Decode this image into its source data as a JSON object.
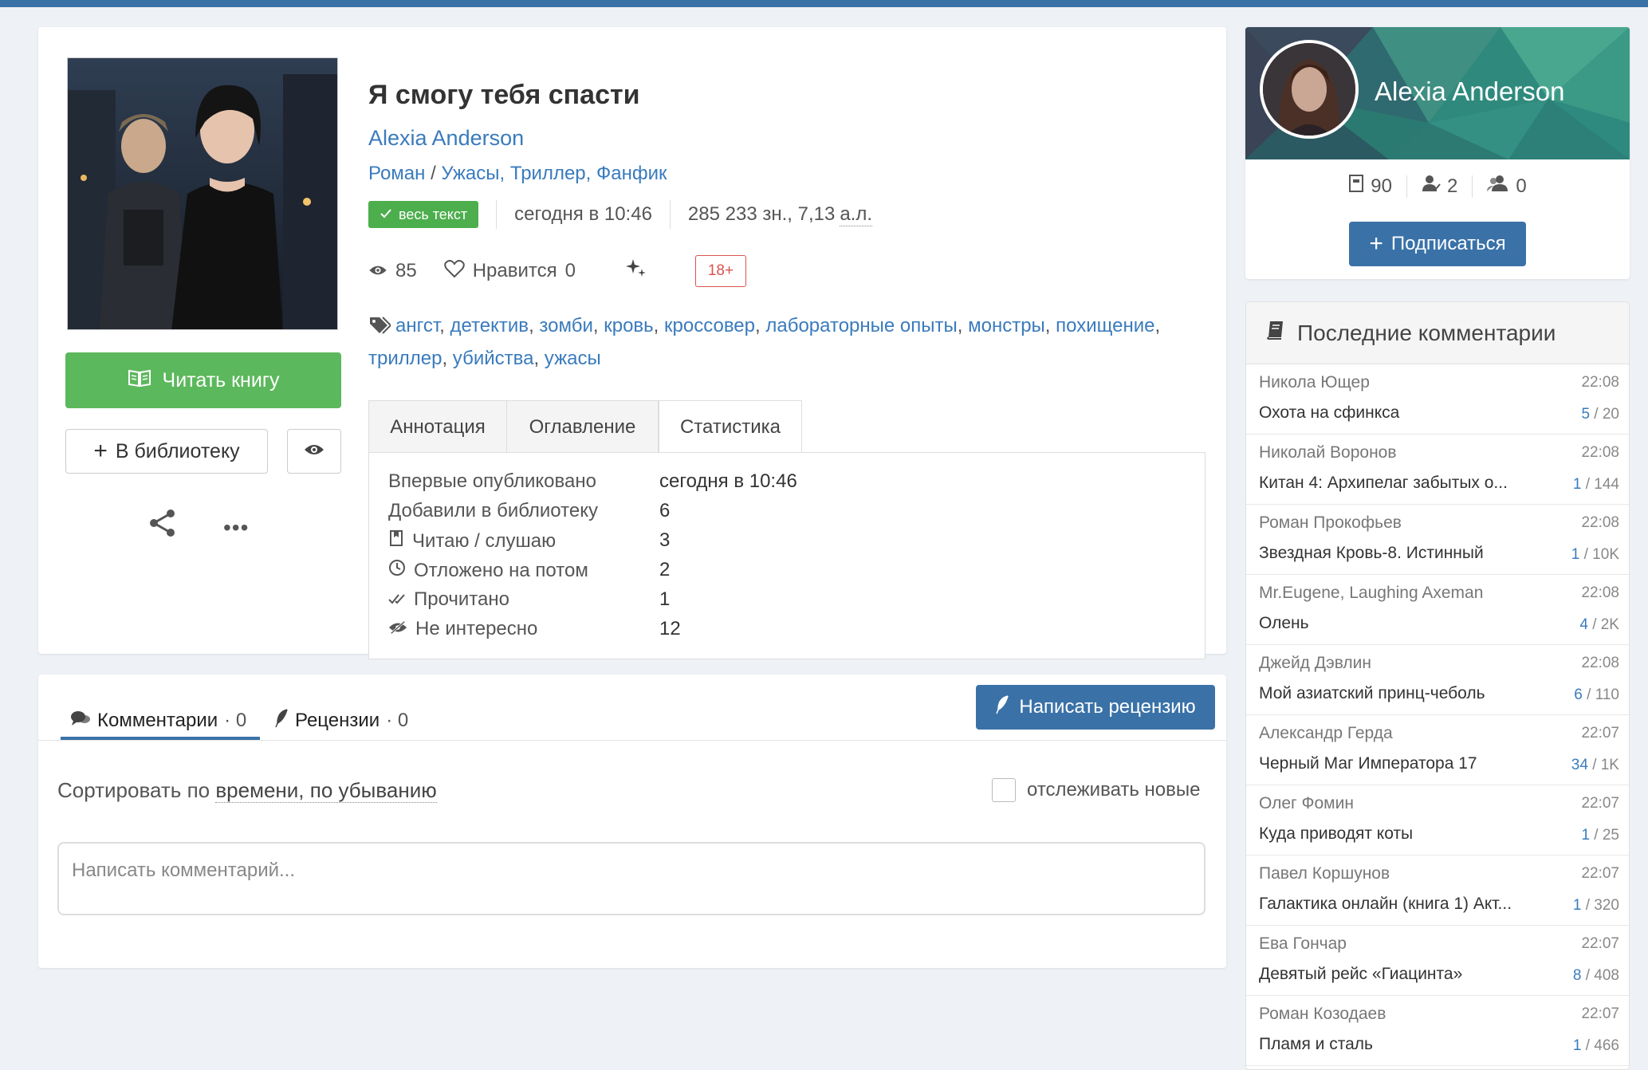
{
  "book": {
    "title": "Я смогу тебя спасти",
    "author": "Alexia Anderson",
    "genre_main": "Роман",
    "genre_sep": "/",
    "genres": [
      "Ужасы,",
      "Триллер,",
      "Фанфик"
    ],
    "status_badge": "весь текст",
    "published": "сегодня в 10:46",
    "size": "285 233 зн., 7,13",
    "size_unit": "а.л.",
    "views": "85",
    "likes_label": "Нравится",
    "likes": "0",
    "age_rating": "18+",
    "tags": [
      "ангст",
      "детектив",
      "зомби",
      "кровь",
      "кроссовер",
      "лабораторные опыты",
      "монстры",
      "похищение",
      "триллер",
      "убийства",
      "ужасы"
    ],
    "read_button": "Читать книгу",
    "library_button": "В библиотеку"
  },
  "tabs": [
    "Аннотация",
    "Оглавление",
    "Статистика"
  ],
  "statistics": [
    {
      "icon": "",
      "label": "Впервые опубликовано",
      "value": "сегодня в 10:46"
    },
    {
      "icon": "",
      "label": "Добавили в библиотеку",
      "value": "6"
    },
    {
      "icon": "bookmark-icon",
      "label": "Читаю / слушаю",
      "value": "3"
    },
    {
      "icon": "clock-icon",
      "label": "Отложено на потом",
      "value": "2"
    },
    {
      "icon": "double-check-icon",
      "label": "Прочитано",
      "value": "1"
    },
    {
      "icon": "eye-slash-icon",
      "label": "Не интересно",
      "value": "12"
    }
  ],
  "comments": {
    "tab_comments": "Комментарии",
    "tab_comments_count": "· 0",
    "tab_reviews": "Рецензии",
    "tab_reviews_count": "· 0",
    "write_review": "Написать рецензию",
    "sort_prefix": "Сортировать по",
    "sort_value": "времени, по убыванию",
    "track_new": "отслеживать новые",
    "input_placeholder": "Написать комментарий..."
  },
  "author_panel": {
    "name": "Alexia Anderson",
    "books": "90",
    "followers": "2",
    "following": "0",
    "subscribe_button": "Подписаться"
  },
  "latest_comments": {
    "title": "Последние комментарии",
    "items": [
      {
        "user": "Никола Ющер",
        "time": "22:08",
        "book": "Охота на сфинкса",
        "new": "5",
        "total": "/ 20"
      },
      {
        "user": "Николай Воронов",
        "time": "22:08",
        "book": "Китан 4: Архипелаг забытых о...",
        "new": "1",
        "total": "/ 144"
      },
      {
        "user": "Роман Прокофьев",
        "time": "22:08",
        "book": "Звездная Кровь-8. Истинный",
        "new": "1",
        "total": "/ 10K"
      },
      {
        "user": "Mr.Eugene, Laughing Axeman",
        "time": "22:08",
        "book": "Олень",
        "new": "4",
        "total": "/ 2K"
      },
      {
        "user": "Джейд Дэвлин",
        "time": "22:08",
        "book": "Мой азиатский принц-чеболь",
        "new": "6",
        "total": "/ 110"
      },
      {
        "user": "Александр Герда",
        "time": "22:07",
        "book": "Черный Маг Императора 17",
        "new": "34",
        "total": "/ 1K"
      },
      {
        "user": "Олег Фомин",
        "time": "22:07",
        "book": "Куда приводят коты",
        "new": "1",
        "total": "/ 25"
      },
      {
        "user": "Павел Коршунов",
        "time": "22:07",
        "book": "Галактика онлайн (книга 1) Акт...",
        "new": "1",
        "total": "/ 320"
      },
      {
        "user": "Ева Гончар",
        "time": "22:07",
        "book": "Девятый рейс «Гиацинта»",
        "new": "8",
        "total": "/ 408"
      },
      {
        "user": "Роман Козодаев",
        "time": "22:07",
        "book": "Пламя и сталь",
        "new": "1",
        "total": "/ 466"
      }
    ]
  },
  "colors": {
    "accent": "#3a72a8",
    "link": "#3a7bbd",
    "read_button": "#5cb85c",
    "age_badge": "#d9534f"
  }
}
